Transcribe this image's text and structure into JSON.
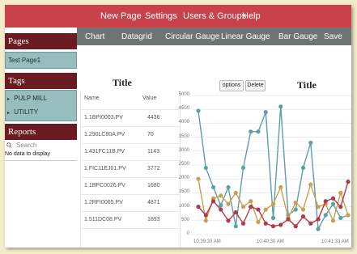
{
  "topnav": {
    "items": [
      "New Page",
      "Settings",
      "Users & Groups",
      "Help"
    ]
  },
  "sidebar": {
    "pages_header": "Pages",
    "pages": [
      "Test Page1"
    ],
    "tags_header": "Tags",
    "tags": [
      "PULP MILL",
      "UTILITY"
    ],
    "reports_header": "Reports",
    "search_placeholder": "Search",
    "no_data": "No data to display"
  },
  "subnav": {
    "tabs": [
      "Chart",
      "Datagrid",
      "Circular Gauge",
      "Linear Gauge",
      "Bar Gauge",
      "Save"
    ]
  },
  "datagrid": {
    "title": "Title",
    "columns": [
      "Name",
      "Value"
    ],
    "rows": [
      {
        "name": "1.1BPI0003.PV",
        "value": "4436"
      },
      {
        "name": "1.290LC80A.PV",
        "value": "70"
      },
      {
        "name": "1.431FC11B.PV",
        "value": "1143"
      },
      {
        "name": "1.FIC11EJ01.PV",
        "value": "3772"
      },
      {
        "name": "1.1BPC0026.PV",
        "value": "1680"
      },
      {
        "name": "1.2RFI0065.PV",
        "value": "4871"
      },
      {
        "name": "1.511DC08.PV",
        "value": "1893"
      }
    ]
  },
  "chart_panel": {
    "options_label": "options",
    "delete_label": "Delete"
  },
  "chart_data": {
    "type": "line",
    "title": "Title",
    "xlabel": "",
    "ylabel": "",
    "ylim": [
      0,
      5000
    ],
    "yticks": [
      0,
      500,
      1000,
      1500,
      2000,
      2500,
      3000,
      3500,
      4000,
      4500,
      5000
    ],
    "xtick_labels": [
      "10:39:30 AM",
      "10:40:30 AM",
      "10:41:33 AM"
    ],
    "series": [
      {
        "color": "#5f9ea8",
        "values": [
          4450,
          2400,
          1700,
          1050,
          1700,
          300,
          2400,
          3700,
          3700,
          4400,
          600,
          4600,
          700,
          900,
          2400,
          3300,
          200,
          700,
          1100,
          600,
          700
        ]
      },
      {
        "color": "#c8a050",
        "values": [
          2000,
          500,
          1300,
          1400,
          1100,
          1500,
          1000,
          1200,
          450,
          900,
          1100,
          1700,
          600,
          1150,
          900,
          1800,
          1000,
          1100,
          500,
          1500,
          700
        ]
      },
      {
        "color": "#b03a4a",
        "values": [
          1000,
          700,
          1200,
          900,
          500,
          800,
          400,
          1000,
          900,
          400,
          300,
          350,
          550,
          300,
          650,
          400,
          550,
          1200,
          1300,
          1000,
          1900
        ]
      }
    ]
  }
}
